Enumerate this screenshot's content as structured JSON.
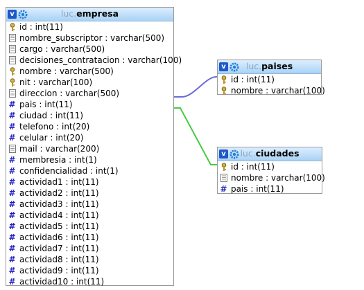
{
  "tables": [
    {
      "id": "empresa",
      "db": "luc.",
      "name": "empresa",
      "columns": [
        {
          "text": "id : int(11)",
          "icon": "key"
        },
        {
          "text": "nombre_subscriptor : varchar(500)",
          "icon": "text"
        },
        {
          "text": "cargo : varchar(500)",
          "icon": "text"
        },
        {
          "text": "decisiones_contratacion : varchar(100)",
          "icon": "text"
        },
        {
          "text": "nombre : varchar(500)",
          "icon": "key"
        },
        {
          "text": "nit : varchar(100)",
          "icon": "key"
        },
        {
          "text": "direccion : varchar(500)",
          "icon": "text"
        },
        {
          "text": "pais : int(11)",
          "icon": "hash"
        },
        {
          "text": "ciudad : int(11)",
          "icon": "hash"
        },
        {
          "text": "telefono : int(20)",
          "icon": "hash"
        },
        {
          "text": "celular : int(20)",
          "icon": "hash"
        },
        {
          "text": "mail : varchar(200)",
          "icon": "text"
        },
        {
          "text": "membresia : int(1)",
          "icon": "hash"
        },
        {
          "text": "confidencialidad : int(1)",
          "icon": "hash"
        },
        {
          "text": "actividad1 : int(11)",
          "icon": "hash"
        },
        {
          "text": "actividad2 : int(11)",
          "icon": "hash"
        },
        {
          "text": "actividad3 : int(11)",
          "icon": "hash"
        },
        {
          "text": "actividad4 : int(11)",
          "icon": "hash"
        },
        {
          "text": "actividad5 : int(11)",
          "icon": "hash"
        },
        {
          "text": "actividad6 : int(11)",
          "icon": "hash"
        },
        {
          "text": "actividad7 : int(11)",
          "icon": "hash"
        },
        {
          "text": "actividad8 : int(11)",
          "icon": "hash"
        },
        {
          "text": "actividad9 : int(11)",
          "icon": "hash"
        },
        {
          "text": "actividad10 : int(11)",
          "icon": "hash"
        }
      ]
    },
    {
      "id": "paises",
      "db": "luc.",
      "name": "paises",
      "columns": [
        {
          "text": "id : int(11)",
          "icon": "key"
        },
        {
          "text": "nombre : varchar(100)",
          "icon": "key"
        }
      ]
    },
    {
      "id": "ciudades",
      "db": "luc.",
      "name": "ciudades",
      "columns": [
        {
          "text": "id : int(11)",
          "icon": "key"
        },
        {
          "text": "nombre : varchar(100)",
          "icon": "text"
        },
        {
          "text": "pais : int(11)",
          "icon": "hash"
        }
      ]
    }
  ],
  "relations": [
    {
      "from": "empresa.pais",
      "to": "paises.id",
      "color": "#6a6ad8"
    },
    {
      "from": "empresa.ciudad",
      "to": "ciudades.id",
      "color": "#44cc44"
    }
  ],
  "colors": {
    "header_top": "#ddeeff",
    "header_bottom": "#a9d2f5",
    "hash": "#2020c0",
    "v_button": "#1e57c8"
  }
}
